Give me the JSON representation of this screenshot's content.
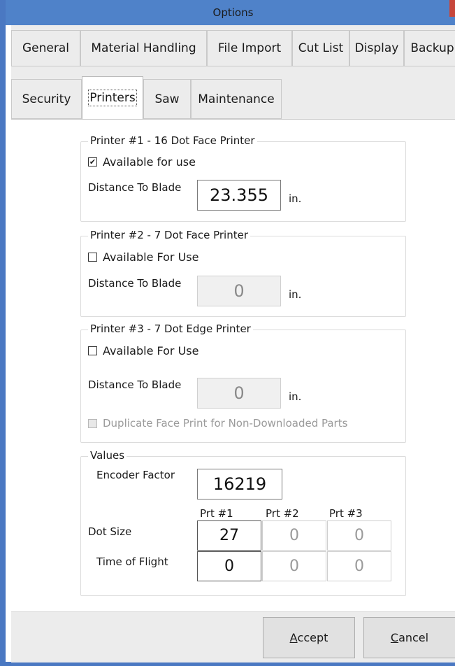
{
  "window": {
    "title": "Options"
  },
  "tabs": {
    "row1": [
      "General",
      "Material Handling",
      "File Import",
      "Cut List",
      "Display",
      "Backup"
    ],
    "row2": [
      "Security",
      "Printers",
      "Saw",
      "Maintenance"
    ],
    "active": "Printers"
  },
  "printer1": {
    "title": "Printer #1  -  16 Dot Face Printer",
    "available_label": "Available for use",
    "available_checked": true,
    "distance_label": "Distance To Blade",
    "distance_value": "23.355",
    "unit": "in."
  },
  "printer2": {
    "title": "Printer #2  -  7 Dot Face Printer",
    "available_label": "Available For Use",
    "available_checked": false,
    "distance_label": "Distance To Blade",
    "distance_value": "0",
    "unit": "in."
  },
  "printer3": {
    "title": "Printer #3  -  7 Dot Edge Printer",
    "available_label": "Available For Use",
    "available_checked": false,
    "distance_label": "Distance To Blade",
    "distance_value": "0",
    "unit": "in.",
    "duplicate_label": "Duplicate Face Print for Non-Downloaded Parts",
    "duplicate_checked": false
  },
  "values": {
    "title": "Values",
    "encoder_label": "Encoder Factor",
    "encoder_value": "16219",
    "columns": [
      "Prt #1",
      "Prt #2",
      "Prt #3"
    ],
    "dot_size_label": "Dot Size",
    "dot_size": [
      "27",
      "0",
      "0"
    ],
    "time_of_flight_label": "Time of Flight",
    "time_of_flight": [
      "0",
      "0",
      "0"
    ]
  },
  "buttons": {
    "accept": {
      "hotkey": "A",
      "rest": "ccept"
    },
    "cancel": {
      "hotkey": "C",
      "rest": "ancel"
    }
  },
  "colors": {
    "titlebar": "#4f82c9",
    "close": "#c7463b",
    "tab_area": "#ececec"
  }
}
